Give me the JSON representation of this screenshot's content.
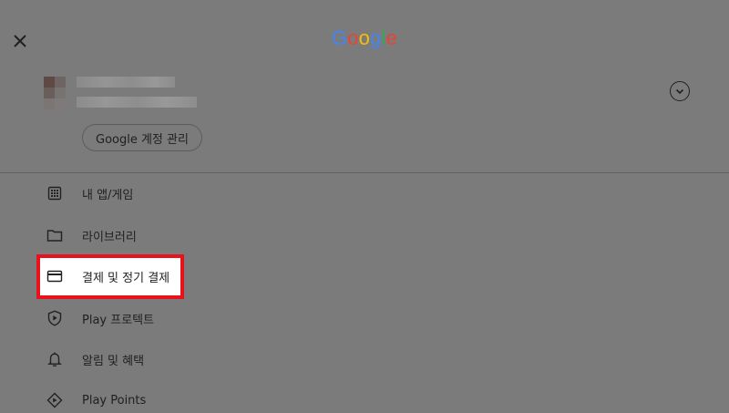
{
  "header": {
    "close_icon": "close-icon",
    "logo_letters": [
      {
        "ch": "G",
        "color": "#4285F4"
      },
      {
        "ch": "o",
        "color": "#EA4335"
      },
      {
        "ch": "o",
        "color": "#FBBC05"
      },
      {
        "ch": "g",
        "color": "#4285F4"
      },
      {
        "ch": "l",
        "color": "#34A853"
      },
      {
        "ch": "e",
        "color": "#EA4335"
      }
    ]
  },
  "account": {
    "manage_button_label": "Google 계정 관리",
    "expand_icon": "chevron-down-icon"
  },
  "menu": {
    "items": [
      {
        "label": "내 앱/게임",
        "icon": "grid-icon"
      },
      {
        "label": "라이브러리",
        "icon": "folder-icon"
      },
      {
        "label": "결제 및 정기 결제",
        "icon": "credit-card-icon"
      },
      {
        "label": "Play 프로텍트",
        "icon": "shield-play-icon"
      },
      {
        "label": "알림 및 혜택",
        "icon": "bell-icon"
      },
      {
        "label": "Play Points",
        "icon": "diamond-icon"
      }
    ]
  },
  "colors": {
    "overlay_background": "#7b7b7b",
    "highlight_border": "#e8121d"
  }
}
